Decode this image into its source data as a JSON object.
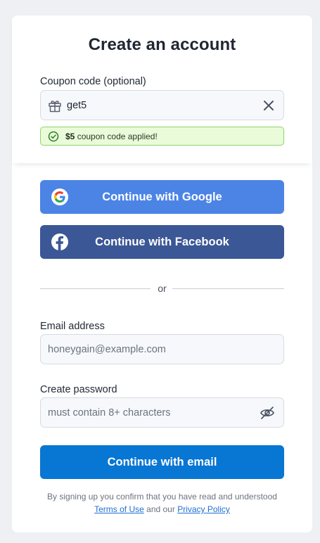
{
  "title": "Create an account",
  "coupon": {
    "label": "Coupon code (optional)",
    "value": "get5",
    "icon": "gift-icon",
    "clear_icon": "close-icon",
    "applied_amount": "$5",
    "applied_message": " coupon code applied!"
  },
  "social": {
    "google_label": "Continue with Google",
    "facebook_label": "Continue with Facebook"
  },
  "divider_text": "or",
  "email": {
    "label": "Email address",
    "placeholder": "honeygain@example.com"
  },
  "password": {
    "label": "Create password",
    "placeholder": "must contain 8+ characters",
    "toggle_icon": "eye-off-icon"
  },
  "email_button_label": "Continue with email",
  "legal": {
    "prefix": "By signing up you confirm that you have read and understood",
    "terms_link": "Terms of Use",
    "middle": " and our ",
    "privacy_link": "Privacy Policy"
  },
  "colors": {
    "google": "#4c84e6",
    "facebook": "#3b5795",
    "email": "#0876d3",
    "success_bg": "#e9fbd9",
    "success_border": "#8fd36a"
  }
}
